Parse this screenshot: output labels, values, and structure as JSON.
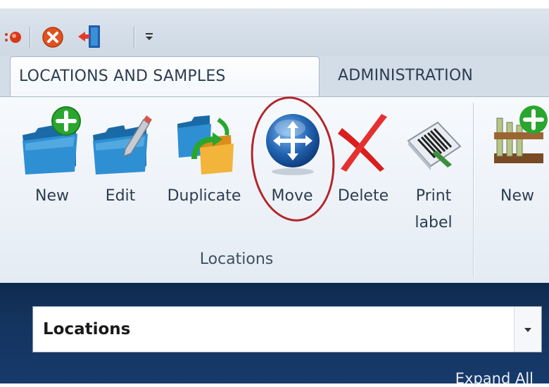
{
  "tabs": [
    {
      "label": "LOCATIONS AND SAMPLES",
      "active": true
    },
    {
      "label": "ADMINISTRATION",
      "active": false
    }
  ],
  "ribbon": {
    "buttons": [
      {
        "label": "New",
        "icon": "folder-add-icon"
      },
      {
        "label": "Edit",
        "icon": "folder-edit-icon"
      },
      {
        "label": "Duplicate",
        "icon": "folder-duplicate-icon"
      },
      {
        "label": "Move",
        "icon": "move-arrows-icon"
      },
      {
        "label": "Delete",
        "icon": "delete-x-icon"
      },
      {
        "label": "Print label",
        "icon": "barcode-label-icon"
      },
      {
        "label": "New",
        "icon": "sample-rack-add-icon"
      }
    ],
    "group_label": "Locations"
  },
  "panel": {
    "selector_value": "Locations",
    "expand_all": "Expand All"
  },
  "colors": {
    "panel_bg": "#143460",
    "highlight": "#b3262b",
    "ribbon_bg": "#edf2f8"
  }
}
